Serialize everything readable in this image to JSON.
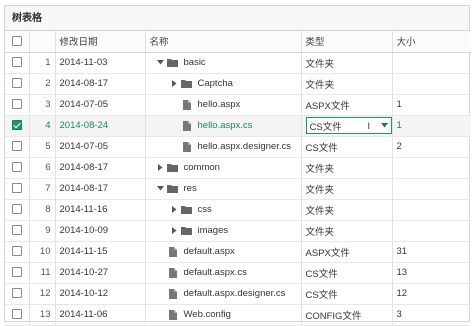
{
  "panel": {
    "title": "树表格"
  },
  "columns": {
    "date": "修改日期",
    "name": "名称",
    "type": "类型",
    "size": "大小"
  },
  "rows": [
    {
      "num": "1",
      "date": "2014-11-03",
      "name": "basic",
      "kind": "folder-open",
      "depth": 0,
      "type": "文件夹",
      "size": "",
      "checked": false
    },
    {
      "num": "2",
      "date": "2014-08-17",
      "name": "Captcha",
      "kind": "folder-closed",
      "depth": 1,
      "type": "文件夹",
      "size": "",
      "checked": false
    },
    {
      "num": "3",
      "date": "2014-07-05",
      "name": "hello.aspx",
      "kind": "file",
      "depth": 1,
      "type": "ASPX文件",
      "size": "1",
      "checked": false
    },
    {
      "num": "4",
      "date": "2014-08-24",
      "name": "hello.aspx.cs",
      "kind": "file",
      "depth": 1,
      "type": "CS文件",
      "size": "1",
      "checked": true
    },
    {
      "num": "5",
      "date": "2014-07-05",
      "name": "hello.aspx.designer.cs",
      "kind": "file",
      "depth": 1,
      "type": "CS文件",
      "size": "2",
      "checked": false
    },
    {
      "num": "6",
      "date": "2014-08-17",
      "name": "common",
      "kind": "folder-closed",
      "depth": 0,
      "type": "文件夹",
      "size": "",
      "checked": false
    },
    {
      "num": "7",
      "date": "2014-08-17",
      "name": "res",
      "kind": "folder-open",
      "depth": 0,
      "type": "文件夹",
      "size": "",
      "checked": false
    },
    {
      "num": "8",
      "date": "2014-11-16",
      "name": "css",
      "kind": "folder-closed",
      "depth": 1,
      "type": "文件夹",
      "size": "",
      "checked": false
    },
    {
      "num": "9",
      "date": "2014-10-09",
      "name": "images",
      "kind": "folder-closed",
      "depth": 1,
      "type": "文件夹",
      "size": "",
      "checked": false
    },
    {
      "num": "10",
      "date": "2014-11-15",
      "name": "default.aspx",
      "kind": "file",
      "depth": 0,
      "type": "ASPX文件",
      "size": "31",
      "checked": false
    },
    {
      "num": "11",
      "date": "2014-10-27",
      "name": "default.aspx.cs",
      "kind": "file",
      "depth": 0,
      "type": "CS文件",
      "size": "13",
      "checked": false
    },
    {
      "num": "12",
      "date": "2014-10-12",
      "name": "default.aspx.designer.cs",
      "kind": "file",
      "depth": 0,
      "type": "CS文件",
      "size": "12",
      "checked": false
    },
    {
      "num": "13",
      "date": "2014-11-06",
      "name": "Web.config",
      "kind": "file",
      "depth": 0,
      "type": "CONFIG文件",
      "size": "3",
      "checked": false
    }
  ],
  "editing_row": "4",
  "colors": {
    "accent": "#1a9a5c",
    "selected_text": "#1d8a53"
  }
}
